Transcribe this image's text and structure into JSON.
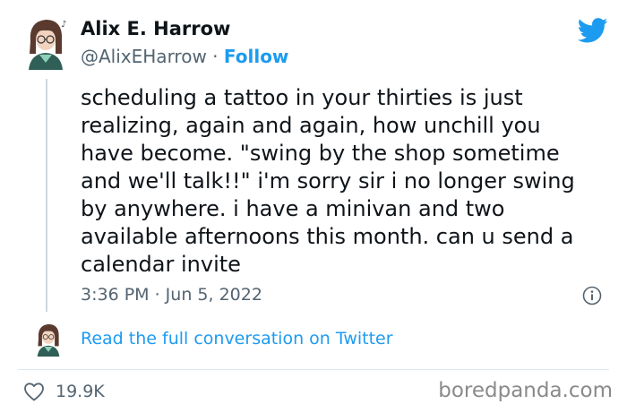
{
  "author": {
    "name": "Alix E. Harrow",
    "handle": "@AlixEHarrow",
    "separator": "·",
    "follow_label": "Follow"
  },
  "tweet": {
    "text": "scheduling a tattoo in your thirties is just\nrealizing, again and again, how unchill you\nhave become. \"swing by the shop sometime\nand we'll talk!!\" i'm sorry sir i no longer swing\nby anywhere. i have a minivan and two\navailable afternoons this month. can u send a\ncalendar invite",
    "timestamp": "3:36 PM · Jun 5, 2022"
  },
  "conversation_link": "Read the full conversation on Twitter",
  "likes": {
    "count": "19.9K"
  },
  "watermark": "boredpanda.com",
  "icons": {
    "brand": "twitter-bird-icon",
    "info": "info-icon",
    "like": "heart-icon"
  },
  "colors": {
    "accent": "#1d9bf0",
    "text": "#0f1419",
    "secondary": "#536471"
  }
}
